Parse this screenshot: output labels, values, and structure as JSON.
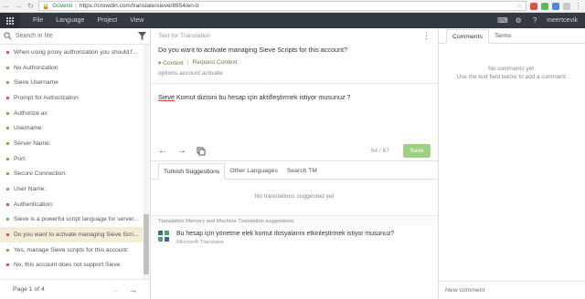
{
  "browser": {
    "secure_label": "Güvenli",
    "url": "https://crowdin.com/translate/sieve/8954/en-tr"
  },
  "topbar": {
    "menu": [
      "File",
      "Language",
      "Project",
      "View"
    ],
    "username": "meertcevik"
  },
  "left": {
    "search_placeholder": "Search in file",
    "strings": [
      {
        "text": "When using proxy authorization you should f...",
        "status": "red"
      },
      {
        "text": "No Authorization",
        "status": "green"
      },
      {
        "text": "Sieve Username",
        "status": "green"
      },
      {
        "text": "Prompt for Authorization",
        "status": "red"
      },
      {
        "text": "Authorize as",
        "status": "green"
      },
      {
        "text": "Username:",
        "status": "green"
      },
      {
        "text": "Server Name:",
        "status": "green"
      },
      {
        "text": "Port:",
        "status": "green"
      },
      {
        "text": "Secure Connection:",
        "status": "green"
      },
      {
        "text": "User Name:",
        "status": "green"
      },
      {
        "text": "Authentication:",
        "status": "red"
      },
      {
        "text": "Sieve is a powerful script language for server...",
        "status": "green"
      },
      {
        "text": "Do you want to activate managing Sieve Scri...",
        "status": "red",
        "selected": true
      },
      {
        "text": "Yes, manage Sieve scripts for this account:",
        "status": "green"
      },
      {
        "text": "No, this account does not support Sieve",
        "status": "red"
      }
    ],
    "pager": "Page 1 of 4",
    "colors": {
      "green": "#76b852",
      "red": "#e05656"
    }
  },
  "editor": {
    "source_label": "Text for Translation",
    "source_text": "Do you want to activate managing Sieve Scripts for this account?",
    "context_label": "Context",
    "request_context_label": "Request Context",
    "string_key": "options.account.activate",
    "translation_word": "Sieve",
    "translation_rest": " Komut dizisini bu hesap için aktifleştirmek istiyor musunuz ?",
    "counter": "64 / 67",
    "save_label": "Save",
    "tabs": [
      "Turkish Suggestions",
      "Other Languages",
      "Search TM"
    ],
    "no_translations": "No translations suggested yet",
    "tm_header": "Translation Memory and Machine Translation suggestions",
    "suggestion_text": "Bu hesap için yönetme elek komut dosyalarını etkinleştirmek istiyor musunuz?",
    "suggestion_source": "Microsoft Translator"
  },
  "comments": {
    "tabs": [
      "Comments",
      "Terms"
    ],
    "empty_line1": "No comments yet.",
    "empty_line2": "Use the text field below to add a comment.",
    "new_comment_placeholder": "New comment"
  }
}
